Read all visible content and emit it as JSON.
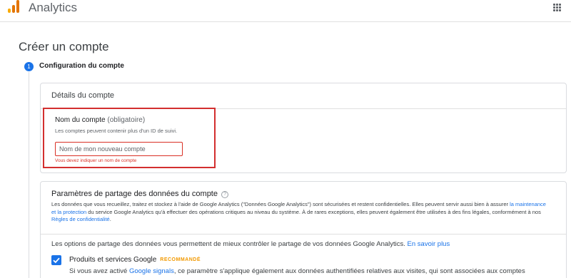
{
  "header": {
    "app_title": "Analytics",
    "logo_colors": [
      "#F9AB00",
      "#E37400",
      "#E37400"
    ],
    "apps_icon": "apps-grid-icon"
  },
  "page": {
    "title": "Créer un compte"
  },
  "stepper": {
    "step_number": "1",
    "step_title": "Configuration du compte",
    "active_color": "#1a73e8"
  },
  "account_details": {
    "title": "Détails du compte",
    "name_field": {
      "label": "Nom du compte",
      "optional_note": "(obligatoire)",
      "help": "Les comptes peuvent contenir plus d'un ID de suivi.",
      "placeholder": "Nom de mon nouveau compte",
      "value": "",
      "error": "Vous devez indiquer un nom de compte",
      "error_color": "#d93025"
    }
  },
  "data_sharing": {
    "title": "Paramètres de partage des données du compte",
    "help_icon": "help-circle-icon",
    "description_part1": "Les données que vous recueillez, traitez et stockez à l'aide de Google Analytics (\"Données Google Analytics\") sont sécurisées et restent confidentielles. Elles peuvent servir aussi bien à assurer ",
    "link_maintenance": "la maintenance et la protection",
    "description_part2": " du service Google Analytics qu'à effectuer des opérations critiques au niveau du système. À de rares exceptions, elles peuvent également être utilisées à des fins légales, conformément à nos ",
    "link_privacy": "Règles de confidentialité",
    "description_part3": ".",
    "options_intro": "Les options de partage des données vous permettent de mieux contrôler le partage de vos données Google Analytics.",
    "learn_more": "En savoir plus",
    "option1": {
      "checked": true,
      "title": "Produits et services Google",
      "badge": "RECOMMANDÉ",
      "text_part1": "Si vous avez activé ",
      "link": "Google signals",
      "text_part2": ", ce paramètre s'applique également aux données authentifiées relatives aux visites, qui sont associées aux comptes"
    }
  }
}
